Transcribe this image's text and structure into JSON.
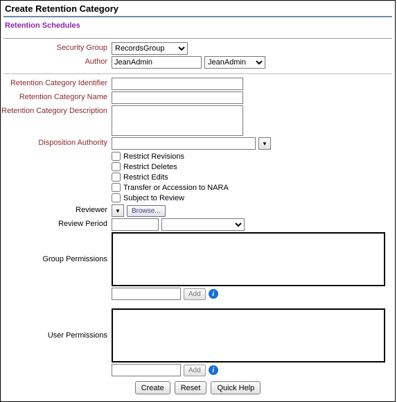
{
  "header": {
    "title": "Create Retention Category",
    "subtitle": "Retention Schedules"
  },
  "labels": {
    "securityGroup": "Security Group",
    "author": "Author",
    "rcIdentifier": "Retention Category Identifier",
    "rcName": "Retention Category Name",
    "rcDescription": "Retention Category Description",
    "dispAuthority": "Disposition Authority",
    "reviewer": "Reviewer",
    "reviewPeriod": "Review Period",
    "groupPermissions": "Group Permissions",
    "userPermissions": "User Permissions"
  },
  "values": {
    "securityGroup": "RecordsGroup",
    "authorText": "JeanAdmin",
    "authorSelect": "JeanAdmin"
  },
  "checkboxes": {
    "restrictRevisions": "Restrict Revisions",
    "restrictDeletes": "Restrict Deletes",
    "restrictEdits": "Restrict Edits",
    "transferNARA": "Transfer or Accession to NARA",
    "subjectReview": "Subject to Review"
  },
  "buttons": {
    "browse": "Browse...",
    "add": "Add",
    "create": "Create",
    "reset": "Reset",
    "quickHelp": "Quick Help"
  }
}
